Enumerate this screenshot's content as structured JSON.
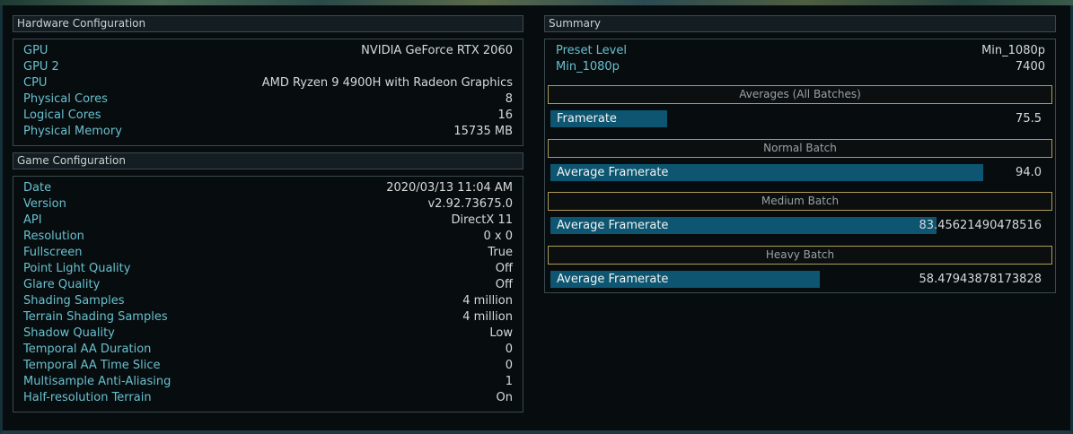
{
  "hardware": {
    "title": "Hardware Configuration",
    "rows": [
      {
        "key": "GPU",
        "value": "NVIDIA GeForce RTX 2060"
      },
      {
        "key": "GPU 2",
        "value": ""
      },
      {
        "key": "CPU",
        "value": "AMD Ryzen 9 4900H with Radeon Graphics"
      },
      {
        "key": "Physical Cores",
        "value": "8"
      },
      {
        "key": "Logical Cores",
        "value": "16"
      },
      {
        "key": "Physical Memory",
        "value": "15735 MB"
      }
    ]
  },
  "game": {
    "title": "Game Configuration",
    "rows": [
      {
        "key": "Date",
        "value": "2020/03/13 11:04 AM"
      },
      {
        "key": "Version",
        "value": "v2.92.73675.0"
      },
      {
        "key": "API",
        "value": "DirectX 11"
      },
      {
        "key": "Resolution",
        "value": "0 x 0"
      },
      {
        "key": "Fullscreen",
        "value": "True"
      },
      {
        "key": "Point Light Quality",
        "value": "Off"
      },
      {
        "key": "Glare Quality",
        "value": "Off"
      },
      {
        "key": "Shading Samples",
        "value": "4 million"
      },
      {
        "key": "Terrain Shading Samples",
        "value": "4 million"
      },
      {
        "key": "Shadow Quality",
        "value": "Low"
      },
      {
        "key": "Temporal AA Duration",
        "value": "0"
      },
      {
        "key": "Temporal AA Time Slice",
        "value": "0"
      },
      {
        "key": "Multisample Anti-Aliasing",
        "value": "1"
      },
      {
        "key": "Half-resolution Terrain",
        "value": "On"
      }
    ]
  },
  "summary": {
    "title": "Summary",
    "rows": [
      {
        "key": "Preset Level",
        "value": "Min_1080p"
      },
      {
        "key": "Min_1080p",
        "value": "7400"
      }
    ],
    "batches": [
      {
        "header": "Averages (All Batches)",
        "label": "Framerate",
        "value": "75.5",
        "fill_fraction": 0.25
      },
      {
        "header": "Normal Batch",
        "label": "Average Framerate",
        "value": "94.0",
        "fill_fraction": 0.93
      },
      {
        "header": "Medium Batch",
        "label": "Average Framerate",
        "value": "83.45621490478516",
        "fill_fraction": 0.83
      },
      {
        "header": "Heavy Batch",
        "label": "Average Framerate",
        "value": "58.47943878173828",
        "fill_fraction": 0.58
      }
    ]
  },
  "colors": {
    "key_text": "#69c0cf",
    "bar_fill": "#0d5570",
    "batch_border": "#b29a55"
  }
}
